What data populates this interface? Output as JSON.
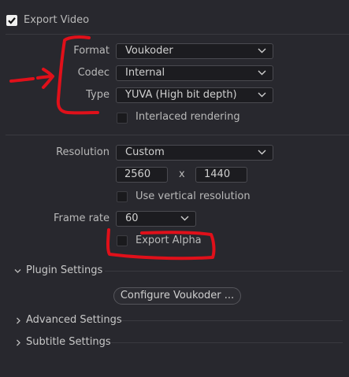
{
  "export_video": {
    "label": "Export Video",
    "checked": true
  },
  "format": {
    "label": "Format",
    "value": "Voukoder"
  },
  "codec": {
    "label": "Codec",
    "value": "Internal"
  },
  "type": {
    "label": "Type",
    "value": "YUVA (High bit depth)"
  },
  "interlaced": {
    "label": "Interlaced rendering",
    "checked": false
  },
  "resolution": {
    "label": "Resolution",
    "value": "Custom",
    "width": "2560",
    "separator": "x",
    "height": "1440"
  },
  "vertical_resolution": {
    "label": "Use vertical resolution",
    "checked": false
  },
  "frame_rate": {
    "label": "Frame rate",
    "value": "60"
  },
  "export_alpha": {
    "label": "Export Alpha",
    "checked": false
  },
  "sections": {
    "plugin_settings": {
      "label": "Plugin Settings",
      "expanded": true
    },
    "advanced_settings": {
      "label": "Advanced Settings",
      "expanded": false
    },
    "subtitle_settings": {
      "label": "Subtitle Settings",
      "expanded": false
    }
  },
  "configure_button": {
    "label": "Configure Voukoder ..."
  },
  "annotation_color": "#e0101a",
  "icons": {
    "dropdown": "chevron-down-icon",
    "collapsed": "chevron-right-icon",
    "expanded": "chevron-down-icon",
    "check": "checkmark-icon"
  }
}
